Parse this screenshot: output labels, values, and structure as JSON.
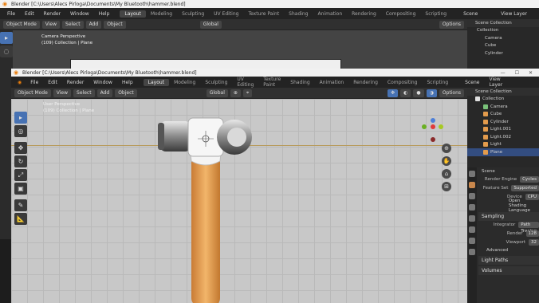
{
  "back_window": {
    "title": "Blender [C:\\Users\\Alecs Pirloga\\Documents\\My Bluetooth\\hammer.blend]",
    "menu": [
      "File",
      "Edit",
      "Render",
      "Window",
      "Help"
    ],
    "workspaces": [
      "Layout",
      "Modeling",
      "Sculpting",
      "UV Editing",
      "Texture Paint",
      "Shading",
      "Animation",
      "Rendering",
      "Compositing",
      "Scripting"
    ],
    "scene_label": "Scene",
    "view_layer_label": "View Layer",
    "mode": "Object Mode",
    "view_menu": [
      "View",
      "Select",
      "Add",
      "Object"
    ],
    "transform": "Global",
    "options": "Options",
    "viewport_overlay": [
      "Camera Perspective",
      "(109) Collection | Plane"
    ],
    "outliner_title": "Scene Collection",
    "outliner_items": [
      "Collection",
      "Camera",
      "Cube",
      "Cylinder"
    ]
  },
  "front_window": {
    "title": "Blender [C:\\Users\\Alecs Pirloga\\Documents\\My Bluetooth\\hammer.blend]",
    "menu": [
      "File",
      "Edit",
      "Render",
      "Window",
      "Help"
    ],
    "workspaces": [
      "Layout",
      "Modeling",
      "Sculpting",
      "UV Editing",
      "Texture Paint",
      "Shading",
      "Animation",
      "Rendering",
      "Compositing",
      "Scripting"
    ],
    "scene_label": "Scene",
    "view_layer_label": "View Layer",
    "mode": "Object Mode",
    "view_menu": [
      "View",
      "Select",
      "Add",
      "Object"
    ],
    "transform": "Global",
    "options": "Options",
    "viewport_overlay": [
      "User Perspective",
      "(109) Collection | Plane"
    ],
    "outliner_title": "Scene Collection",
    "outliner_items": [
      {
        "label": "Collection",
        "color": "#e0e0e0"
      },
      {
        "label": "Camera",
        "color": "#7ac27a"
      },
      {
        "label": "Cube",
        "color": "#e39b4c"
      },
      {
        "label": "Cylinder",
        "color": "#e39b4c"
      },
      {
        "label": "Light.001",
        "color": "#e39b4c"
      },
      {
        "label": "Light.002",
        "color": "#e39b4c"
      },
      {
        "label": "Light",
        "color": "#e39b4c"
      },
      {
        "label": "Plane",
        "color": "#e39b4c"
      }
    ],
    "properties": {
      "scene_name": "Scene",
      "render_engine_label": "Render Engine",
      "render_engine": "Cycles",
      "feature_set_label": "Feature Set",
      "feature_set": "Supported",
      "device_label": "Device",
      "device": "CPU",
      "osl": "Open Shading Language",
      "sampling": "Sampling",
      "integrator_label": "Integrator",
      "integrator": "Path Tracing",
      "render_label": "Render",
      "render_value": "128",
      "viewport_label": "Viewport",
      "viewport_value": "32",
      "advanced": "Advanced",
      "light_paths": "Light Paths",
      "volumes": "Volumes"
    }
  }
}
